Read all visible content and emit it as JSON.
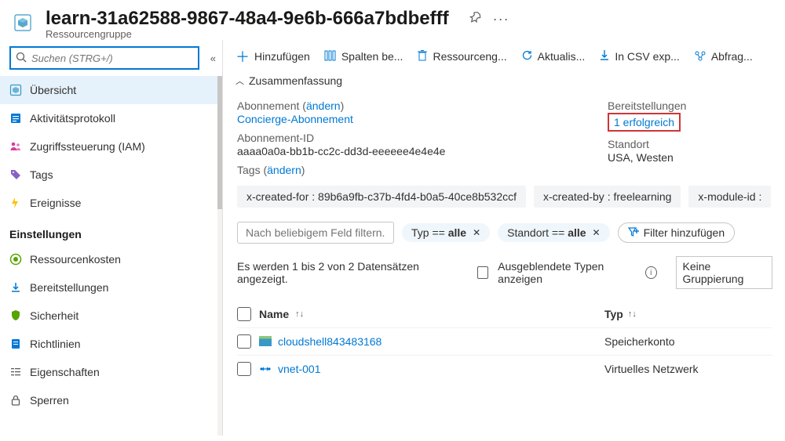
{
  "header": {
    "title": "learn-31a62588-9867-48a4-9e6b-666a7bdbefff",
    "subtitle": "Ressourcengruppe",
    "search_placeholder": "Suchen (STRG+/)"
  },
  "sidebar": {
    "items": [
      {
        "label": "Übersicht",
        "icon": "overview-icon",
        "selected": true
      },
      {
        "label": "Aktivitätsprotokoll",
        "icon": "activity-log-icon",
        "selected": false
      },
      {
        "label": "Zugriffssteuerung (IAM)",
        "icon": "iam-icon",
        "selected": false
      },
      {
        "label": "Tags",
        "icon": "tags-icon",
        "selected": false
      },
      {
        "label": "Ereignisse",
        "icon": "events-icon",
        "selected": false
      }
    ],
    "settings_label": "Einstellungen",
    "settings_items": [
      {
        "label": "Ressourcenkosten",
        "icon": "cost-icon"
      },
      {
        "label": "Bereitstellungen",
        "icon": "deployments-icon"
      },
      {
        "label": "Sicherheit",
        "icon": "security-icon"
      },
      {
        "label": "Richtlinien",
        "icon": "policies-icon"
      },
      {
        "label": "Eigenschaften",
        "icon": "properties-icon"
      },
      {
        "label": "Sperren",
        "icon": "locks-icon"
      }
    ]
  },
  "cmdbar": {
    "add": "Hinzufügen",
    "columns": "Spalten be...",
    "delete": "Ressourceng...",
    "refresh": "Aktualis...",
    "export": "In CSV exp...",
    "query": "Abfrag..."
  },
  "summary": {
    "section_label": "Zusammenfassung",
    "sub_label": "Abonnement",
    "change": "ändern",
    "sub_value": "Concierge-Abonnement",
    "subid_label": "Abonnement-ID",
    "subid_value": "aaaa0a0a-bb1b-cc2c-dd3d-eeeeee4e4e4e",
    "tags_label": "Tags",
    "deploy_label": "Bereitstellungen",
    "deploy_value": "1 erfolgreich",
    "loc_label": "Standort",
    "loc_value": "USA, Westen"
  },
  "tags": [
    "x-created-for : 89b6a9fb-c37b-4fd4-b0a5-40ce8b532ccf",
    "x-created-by : freelearning",
    "x-module-id :"
  ],
  "filters": {
    "placeholder": "Nach beliebigem Feld filtern...",
    "type_label": "Typ == ",
    "type_value": "alle",
    "loc_label": "Standort == ",
    "loc_value": "alle",
    "add_filter": "Filter hinzufügen"
  },
  "status": {
    "record_text": "Es werden 1 bis 2 von 2 Datensätzen angezeigt.",
    "hidden_label": "Ausgeblendete Typen anzeigen",
    "group_label": "Keine Gruppierung"
  },
  "table": {
    "col_name": "Name",
    "col_type": "Typ",
    "rows": [
      {
        "name": "cloudshell843483168",
        "type": "Speicherkonto",
        "icon": "storage-icon"
      },
      {
        "name": "vnet-001",
        "type": "Virtuelles Netzwerk",
        "icon": "vnet-icon"
      }
    ]
  }
}
